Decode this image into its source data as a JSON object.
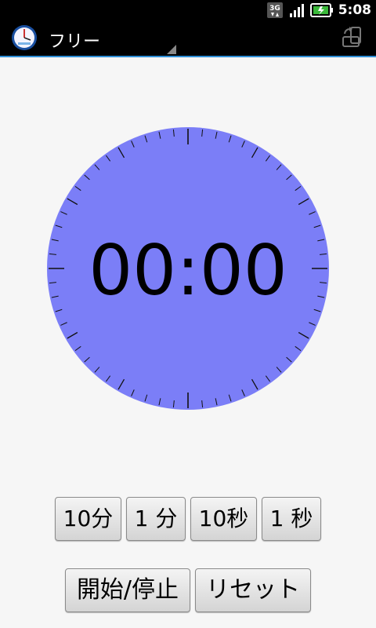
{
  "status_bar": {
    "network_label": "3G",
    "time": "5:08"
  },
  "title_bar": {
    "title": "フリー"
  },
  "timer": {
    "display": "00:00",
    "dial_color": "#7b7ef7"
  },
  "buttons": {
    "ten_minutes": "10分",
    "one_minute": "1 分",
    "ten_seconds": "10秒",
    "one_second": "1 秒",
    "start_stop": "開始/停止",
    "reset": "リセット"
  },
  "icons": {
    "app": "stopwatch-icon",
    "rotate": "rotate-screen-icon",
    "signal": "signal-icon",
    "battery": "battery-icon"
  }
}
